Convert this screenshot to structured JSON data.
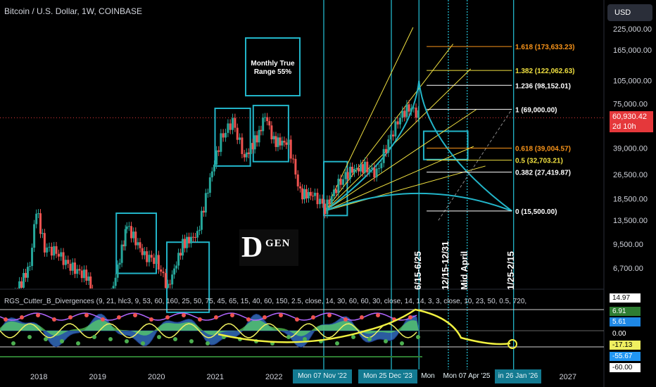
{
  "header": {
    "title": "Bitcoin / U.S. Dollar, 1W, COINBASE",
    "currency": "USD",
    "last_price": "60,930.42",
    "countdown": "2d 10h"
  },
  "annotation": {
    "line1": "Monthly True",
    "line2": "Range 55%"
  },
  "logo": {
    "letter": "D",
    "text": "GEN"
  },
  "indicator_title": "RGS_Cutter_B_Divergences (9, 21, hlc3, 9, 53, 60, 160, 25, 50, 75, 45, 65, 15, 40, 60, 150, 2.5, close, 14, 30, 60, 60, 30, close, 14, 14, 3, 3, close, 10, 23, 50, 0.5, 720,",
  "vertical_labels": [
    "6/15-6/25",
    "12/15-12/31",
    "Mid April",
    "1/25-2/15"
  ],
  "date_tags": [
    "Mon 07 Nov '22",
    "Mon 25 Dec '23",
    "Mon",
    "Mon 07 Apr '25",
    "in 26 Jan '26"
  ],
  "colors": {
    "accent": "#22b5c9",
    "bull": "#26a69a",
    "bear": "#ef5350",
    "fib": "#f0e040",
    "price_tag": "#e5383b"
  },
  "chart_data": [
    {
      "type": "candlestick",
      "title": "Bitcoin / U.S. Dollar, 1W, COINBASE",
      "scale": "log",
      "y_ticks": [
        225000,
        165000,
        105000,
        75000,
        39000,
        26500,
        18500,
        13500,
        9500,
        6700
      ],
      "y_tick_labels": [
        "225,000.00",
        "165,000.00",
        "105,000.00",
        "75,000.00",
        "39,000.00",
        "26,500.00",
        "18,500.00",
        "13,500.00",
        "9,500.00",
        "6,700.00"
      ],
      "x_tick_labels": [
        "2018",
        "2019",
        "2020",
        "2021",
        "2022",
        "2023",
        "2024",
        "2025",
        "2026",
        "2027"
      ],
      "x_ticks": [
        2018.0,
        2019.0,
        2020.0,
        2021.0,
        2022.0,
        2023.0,
        2024.0,
        2025.0,
        2026.0,
        2027.0
      ],
      "last_price": 60930.42,
      "price_path": [
        [
          2017.6,
          4500
        ],
        [
          2017.85,
          7000
        ],
        [
          2017.96,
          16000
        ],
        [
          2018.1,
          9000
        ],
        [
          2018.3,
          8500
        ],
        [
          2018.5,
          7000
        ],
        [
          2018.85,
          5800
        ],
        [
          2018.95,
          3700
        ],
        [
          2019.2,
          4000
        ],
        [
          2019.45,
          10000
        ],
        [
          2019.5,
          12500
        ],
        [
          2019.8,
          8000
        ],
        [
          2020.0,
          7500
        ],
        [
          2020.2,
          5000
        ],
        [
          2020.45,
          9500
        ],
        [
          2020.7,
          11000
        ],
        [
          2020.95,
          28000
        ],
        [
          2021.1,
          45000
        ],
        [
          2021.3,
          58000
        ],
        [
          2021.5,
          34000
        ],
        [
          2021.75,
          48000
        ],
        [
          2021.85,
          64000
        ],
        [
          2022.0,
          43000
        ],
        [
          2022.25,
          42000
        ],
        [
          2022.45,
          20000
        ],
        [
          2022.7,
          19500
        ],
        [
          2022.87,
          16000
        ],
        [
          2023.1,
          23000
        ],
        [
          2023.3,
          28000
        ],
        [
          2023.55,
          29500
        ],
        [
          2023.75,
          27000
        ],
        [
          2023.95,
          43000
        ],
        [
          2024.15,
          62000
        ],
        [
          2024.3,
          71000
        ],
        [
          2024.42,
          66000
        ],
        [
          2024.5,
          60930
        ]
      ],
      "fib_levels": [
        {
          "label": "1.618 (173,633.23)",
          "value": 173633.23,
          "color": "#f7931a"
        },
        {
          "label": "1.382 (122,062.63)",
          "value": 122062.63,
          "color": "#f0e040"
        },
        {
          "label": "1.236 (98,152.01)",
          "value": 98152.01,
          "color": "#ffffff"
        },
        {
          "label": "1 (69,000.00)",
          "value": 69000,
          "color": "#ffffff"
        },
        {
          "label": "0.618 (39,004.57)",
          "value": 39004.57,
          "color": "#f7931a"
        },
        {
          "label": "0.5 (32,703.21)",
          "value": 32703.21,
          "color": "#f0e040"
        },
        {
          "label": "0.382 (27,419.87)",
          "value": 27419.87,
          "color": "#ffffff"
        },
        {
          "label": "0 (15,500.00)",
          "value": 15500,
          "color": "#ffffff"
        }
      ],
      "fan_origin": [
        2022.87,
        15500
      ],
      "fan_targets": [
        [
          2024.37,
          230000
        ],
        [
          2025.05,
          180000
        ],
        [
          2025.35,
          125000
        ],
        [
          2025.45,
          69000
        ],
        [
          2025.4,
          40000
        ],
        [
          2025.6,
          30000
        ]
      ],
      "vertical_lines": [
        2022.85,
        2024.0,
        2024.47,
        2024.97,
        2025.29,
        2026.08
      ],
      "boxes": [
        {
          "x": [
            2019.32,
            2020.0
          ],
          "y": [
            6200,
            15000
          ]
        },
        {
          "x": [
            2020.18,
            2020.9
          ],
          "y": [
            3500,
            9800
          ]
        },
        {
          "x": [
            2021.0,
            2021.6
          ],
          "y": [
            30000,
            70000
          ]
        },
        {
          "x": [
            2021.65,
            2022.25
          ],
          "y": [
            32000,
            73000
          ]
        },
        {
          "x": [
            2022.85,
            2023.25
          ],
          "y": [
            14500,
            32000
          ]
        },
        {
          "x": [
            2024.55,
            2025.3
          ],
          "y": [
            33000,
            50000
          ]
        }
      ]
    },
    {
      "type": "line",
      "title": "RGS_Cutter_B_Divergences",
      "y_tick_labels": [
        "14.97",
        "6.91",
        "5.61",
        "0.00",
        "-17.13",
        "-55.67",
        "-60.00"
      ],
      "y_ticks": [
        14.97,
        6.91,
        5.61,
        0.0,
        -17.13,
        -55.67,
        -60.0
      ],
      "value_badges": [
        {
          "value": "14.97",
          "color": "#ffffff"
        },
        {
          "value": "6.91",
          "color": "#2e7d32"
        },
        {
          "value": "5.61",
          "color": "#1e88e5"
        },
        {
          "value": "0.00",
          "color": "#000000"
        },
        {
          "value": "-17.13",
          "color": "#f0f060"
        },
        {
          "value": "-55.67",
          "color": "#2196f3"
        },
        {
          "value": "-60.00",
          "color": "#ffffff"
        }
      ]
    }
  ]
}
